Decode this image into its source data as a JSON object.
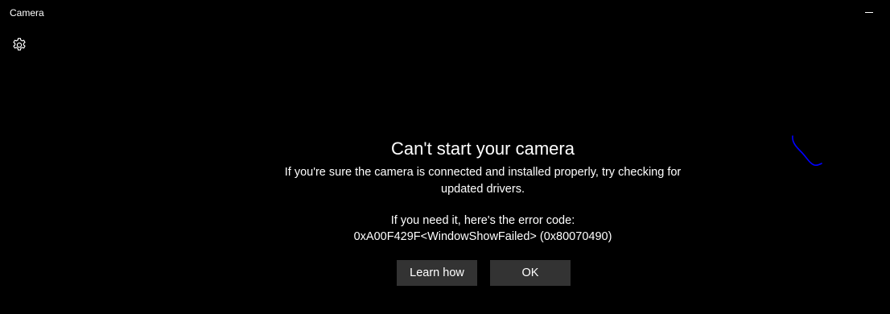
{
  "window": {
    "title": "Camera"
  },
  "icons": {
    "settings": "gear-icon",
    "minimize": "minimize-icon"
  },
  "error": {
    "heading": "Can't start your camera",
    "message": "If you're sure the camera is connected and installed properly, try checking for updated drivers.",
    "code_label": "If you need it, here's the error code:",
    "code": "0xA00F429F<WindowShowFailed> (0x80070490)"
  },
  "buttons": {
    "learn_how": "Learn how",
    "ok": "OK"
  },
  "colors": {
    "background": "#000000",
    "text": "#ffffff",
    "button": "#333333",
    "scribble": "#0000ff"
  }
}
